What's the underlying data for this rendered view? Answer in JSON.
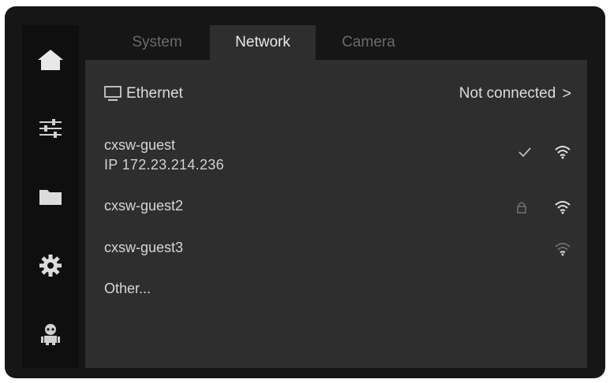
{
  "sidebar": {
    "items": [
      {
        "icon": "home-icon"
      },
      {
        "icon": "sliders-icon"
      },
      {
        "icon": "folder-icon"
      },
      {
        "icon": "gear-icon"
      },
      {
        "icon": "robot-icon"
      }
    ]
  },
  "tabs": [
    {
      "label": "System",
      "active": false
    },
    {
      "label": "Network",
      "active": true
    },
    {
      "label": "Camera",
      "active": false
    }
  ],
  "ethernet": {
    "label": "Ethernet",
    "status": "Not connected",
    "chevron": ">"
  },
  "networks": [
    {
      "name": "cxsw-guest",
      "ip": "IP 172.23.214.236",
      "connected": true,
      "locked": false,
      "signal": "full"
    },
    {
      "name": "cxsw-guest2",
      "connected": false,
      "locked": true,
      "signal": "full"
    },
    {
      "name": "cxsw-guest3",
      "connected": false,
      "locked": false,
      "signal": "weak"
    }
  ],
  "other_label": "Other..."
}
